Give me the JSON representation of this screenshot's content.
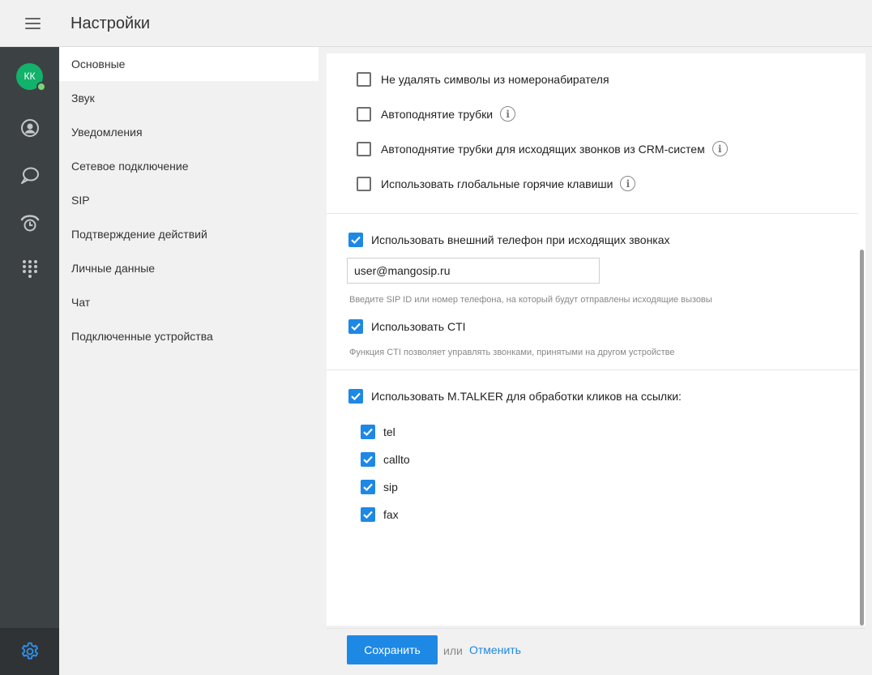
{
  "header": {
    "title": "Настройки",
    "menu_icon": "hamburger-menu-icon"
  },
  "rail": {
    "avatar_initials": "КК",
    "avatar_color": "#12b26a",
    "presence_color": "#7cd67a",
    "icons": [
      "contacts-icon",
      "chat-icon",
      "call-history-icon",
      "dialpad-icon",
      "gear-icon"
    ]
  },
  "menu": {
    "items": [
      {
        "label": "Основные",
        "active": true
      },
      {
        "label": "Звук"
      },
      {
        "label": "Уведомления"
      },
      {
        "label": "Сетевое подключение"
      },
      {
        "label": "SIP"
      },
      {
        "label": "Подтверждение действий"
      },
      {
        "label": "Личные данные"
      },
      {
        "label": "Чат"
      },
      {
        "label": "Подключенные устройства"
      }
    ]
  },
  "options": {
    "no_delete_symbols": {
      "label": "Не удалять символы из номеронабирателя",
      "checked": false
    },
    "auto_answer": {
      "label": "Автоподнятие трубки",
      "checked": false
    },
    "auto_answer_crm": {
      "label": "Автоподнятие трубки для исходящих звонков из CRM-систем",
      "checked": false
    },
    "global_hotkeys": {
      "label": "Использовать глобальные горячие клавиши",
      "checked": false
    },
    "external_phone": {
      "label": "Использовать внешний телефон при исходящих звонках",
      "checked": true,
      "value": "user@mangosip.ru",
      "hint": "Введите SIP ID или номер телефона, на который будут отправлены исходящие вызовы"
    },
    "cti": {
      "label": "Использовать CTI",
      "checked": true,
      "hint": "Функция CTI позволяет управлять звонками, принятыми на другом устройстве"
    },
    "mtalker_links": {
      "label": "Использовать M.TALKER для обработки кликов на ссылки:",
      "checked": true,
      "protocols": [
        {
          "label": "tel",
          "checked": true
        },
        {
          "label": "callto",
          "checked": true
        },
        {
          "label": "sip",
          "checked": true
        },
        {
          "label": "fax",
          "checked": true
        }
      ]
    }
  },
  "footer": {
    "save_label": "Сохранить",
    "or_label": "или",
    "cancel_label": "Отменить"
  },
  "colors": {
    "accent": "#1e88e5",
    "rail_bg": "#3c4144"
  }
}
